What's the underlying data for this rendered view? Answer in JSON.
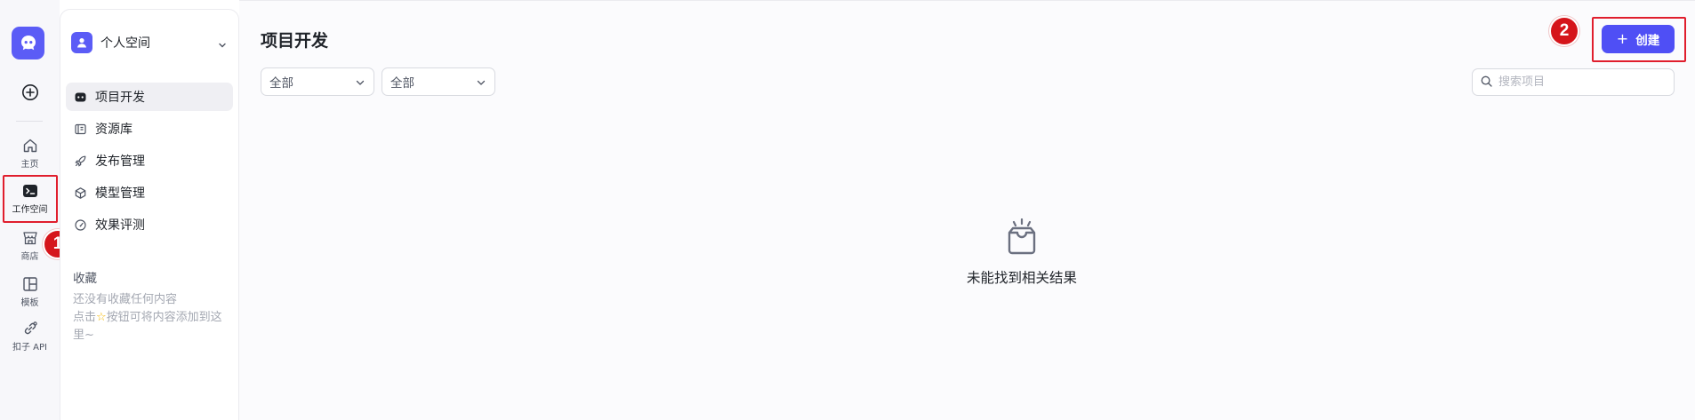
{
  "rail": {
    "items": [
      {
        "label": "主页",
        "icon": "home-icon"
      },
      {
        "label": "工作空间",
        "icon": "terminal-icon"
      },
      {
        "label": "商店",
        "icon": "store-icon"
      },
      {
        "label": "模板",
        "icon": "layout-icon"
      },
      {
        "label": "扣子 API",
        "icon": "link-icon"
      }
    ]
  },
  "subnav": {
    "space_name": "个人空间",
    "items": [
      {
        "label": "项目开发",
        "icon": "bot-icon"
      },
      {
        "label": "资源库",
        "icon": "library-icon"
      },
      {
        "label": "发布管理",
        "icon": "rocket-icon"
      },
      {
        "label": "模型管理",
        "icon": "cube-icon"
      },
      {
        "label": "效果评测",
        "icon": "gauge-icon"
      }
    ],
    "favorites_title": "收藏",
    "favorites_empty_line1": "还没有收藏任何内容",
    "favorites_empty_line2_prefix": "点击",
    "favorites_empty_line2_suffix": "按钮可将内容添加到这里~"
  },
  "main": {
    "title": "项目开发",
    "filter1": "全部",
    "filter2": "全部",
    "search_placeholder": "搜索项目",
    "create_label": "创建",
    "empty_text": "未能找到相关结果"
  },
  "annotations": {
    "marker1": "1",
    "marker2": "2"
  },
  "colors": {
    "accent": "#4f4ff5",
    "highlight": "#e01e2d"
  }
}
